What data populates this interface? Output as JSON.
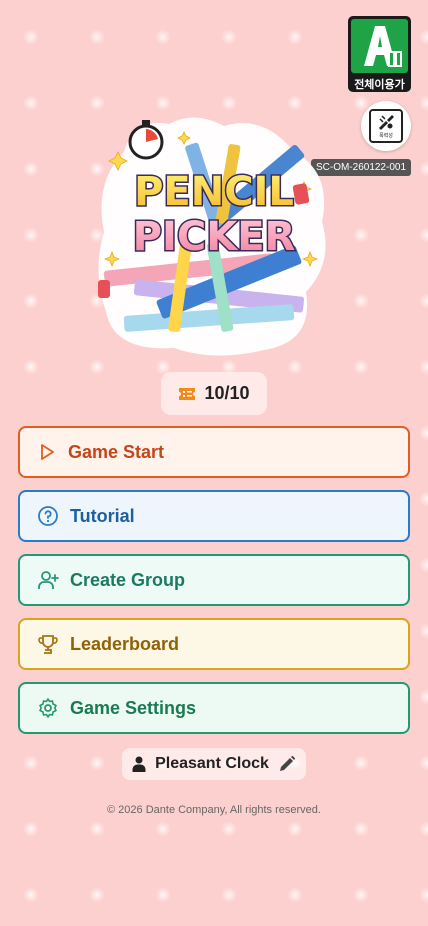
{
  "rating": {
    "age_mark": "ALL",
    "age_label": "전체이용가",
    "descriptor": "폭력성",
    "code": "SC-OM-260122-001"
  },
  "logo": {
    "line1": "PENCIL",
    "line2": "PICKER"
  },
  "tickets": {
    "icon": "ticket-icon",
    "count": "10/10"
  },
  "menu": {
    "start": {
      "label": "Game Start",
      "icon": "play-icon"
    },
    "tutorial": {
      "label": "Tutorial",
      "icon": "help-circle-icon"
    },
    "group": {
      "label": "Create Group",
      "icon": "user-plus-icon"
    },
    "leaderboard": {
      "label": "Leaderboard",
      "icon": "trophy-icon"
    },
    "settings": {
      "label": "Game Settings",
      "icon": "gear-icon"
    }
  },
  "user": {
    "name": "Pleasant Clock",
    "icon": "person-icon",
    "edit_icon": "pencil-icon"
  },
  "footer": {
    "copyright": "© 2026 Dante Company, All rights reserved."
  },
  "colors": {
    "background": "#fcd0cf",
    "start": "#e05d24",
    "tutorial": "#2b7cc7",
    "group": "#26987a",
    "leaderboard": "#d9a320",
    "settings": "#26986f"
  }
}
